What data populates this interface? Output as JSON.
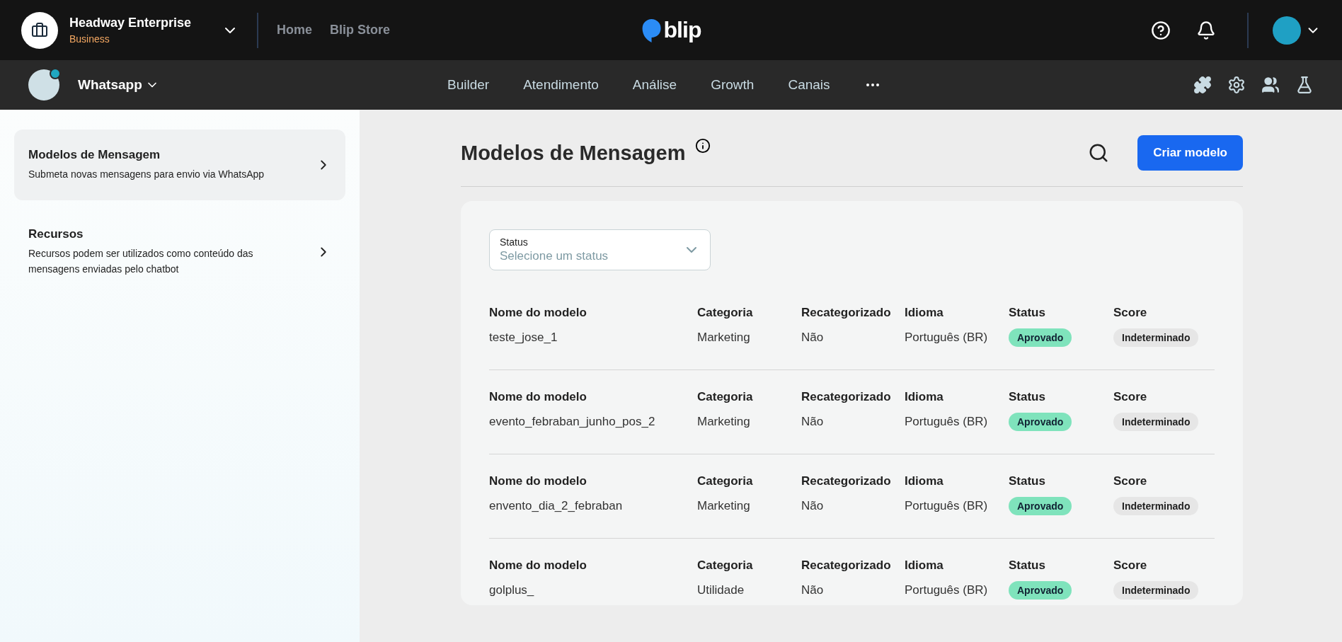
{
  "topbar": {
    "org_name": "Headway Enterprise",
    "org_plan": "Business",
    "links": [
      "Home",
      "Blip Store"
    ],
    "logo": "blip"
  },
  "navbar": {
    "bot_name": "Whatsapp",
    "items": [
      {
        "label": "Builder",
        "selected": false
      },
      {
        "label": "Atendimento",
        "selected": false
      },
      {
        "label": "Análise",
        "selected": false
      },
      {
        "label": "Growth",
        "selected": false
      },
      {
        "label": "Canais",
        "selected": false
      }
    ]
  },
  "sidebar": {
    "items": [
      {
        "title": "Modelos de Mensagem",
        "description": "Submeta novas mensagens para envio via WhatsApp",
        "selected": true
      },
      {
        "title": "Recursos",
        "description": "Recursos podem ser utilizados como conteúdo das mensagens enviadas pelo chatbot",
        "selected": false
      }
    ]
  },
  "page": {
    "title": "Modelos de Mensagem",
    "create_button": "Criar modelo"
  },
  "status_filter": {
    "label": "Status",
    "placeholder": "Selecione um status"
  },
  "templates": [
    {
      "headers": [
        "Nome do modelo",
        "Categoria",
        "Recategorizado",
        "Idioma",
        "Status",
        "Score"
      ],
      "name": "teste_jose_1",
      "category": "Marketing",
      "recategorized": "Não",
      "language": "Português (BR)",
      "status": "Aprovado",
      "score": "Indeterminado"
    },
    {
      "headers": [
        "Nome do modelo",
        "Categoria",
        "Recategorizado",
        "Idioma",
        "Status",
        "Score"
      ],
      "name": "evento_febraban_junho_pos_2",
      "category": "Marketing",
      "recategorized": "Não",
      "language": "Português (BR)",
      "status": "Aprovado",
      "score": "Indeterminado"
    },
    {
      "headers": [
        "Nome do modelo",
        "Categoria",
        "Recategorizado",
        "Idioma",
        "Status",
        "Score"
      ],
      "name": "envento_dia_2_febraban",
      "category": "Marketing",
      "recategorized": "Não",
      "language": "Português (BR)",
      "status": "Aprovado",
      "score": "Indeterminado"
    },
    {
      "headers": [
        "Nome do modelo",
        "Categoria",
        "Recategorizado",
        "Idioma",
        "Status",
        "Score"
      ],
      "name": "golplus_",
      "category": "Utilidade",
      "recategorized": "Não",
      "language": "Português (BR)",
      "status": "Aprovado",
      "score": "Indeterminado"
    }
  ]
}
